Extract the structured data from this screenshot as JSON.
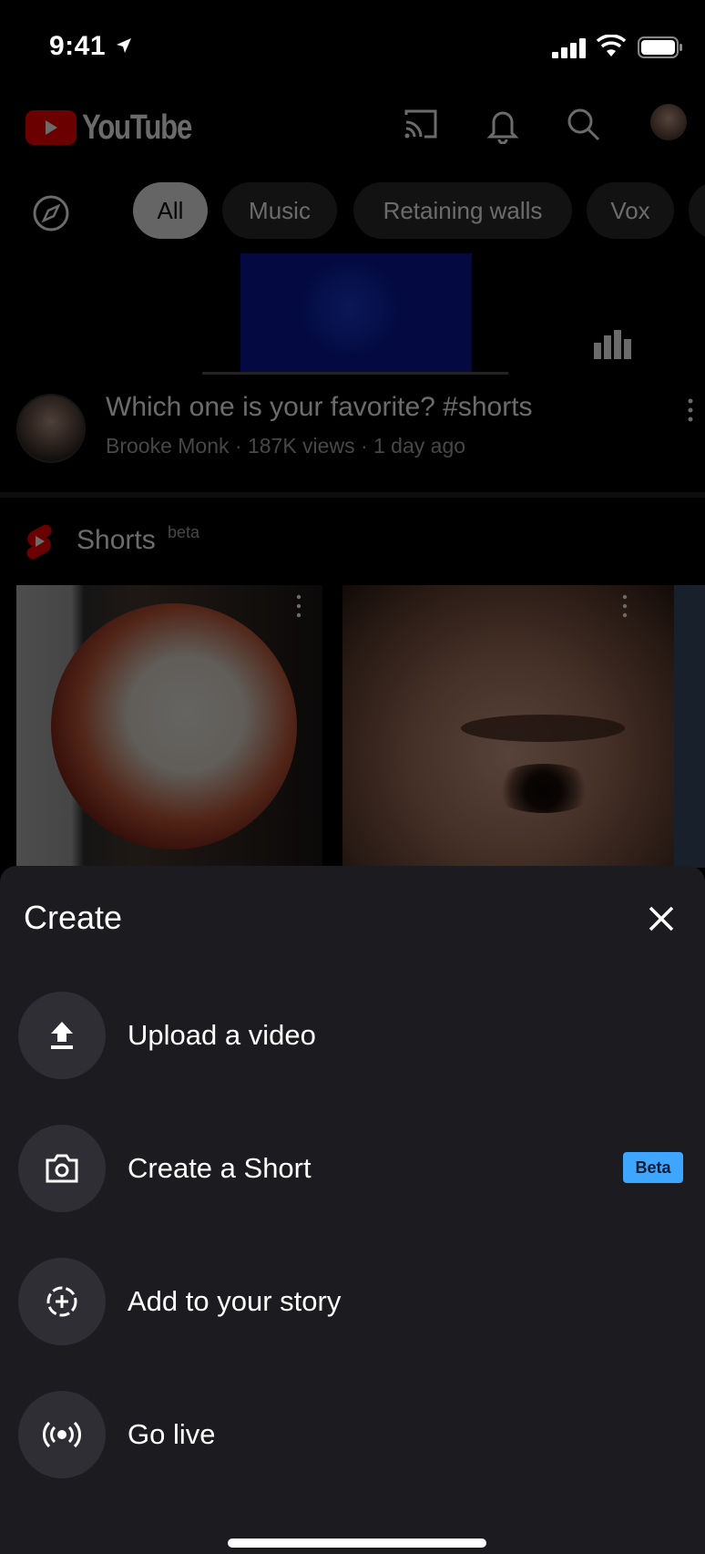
{
  "status_bar": {
    "time": "9:41"
  },
  "header": {
    "logo_text": "YouTube"
  },
  "chips": [
    {
      "label": "All",
      "active": true
    },
    {
      "label": "Music",
      "active": false
    },
    {
      "label": "Retaining walls",
      "active": false
    },
    {
      "label": "Vox",
      "active": false
    }
  ],
  "video": {
    "title": "Which one is your favorite? #shorts",
    "meta": "Brooke Monk · 187K views · 1 day ago"
  },
  "shorts": {
    "label": "Shorts",
    "badge": "beta"
  },
  "create_sheet": {
    "title": "Create",
    "items": [
      {
        "label": "Upload a video",
        "icon": "upload-icon"
      },
      {
        "label": "Create a Short",
        "icon": "camera-icon",
        "badge": "Beta"
      },
      {
        "label": "Add to your story",
        "icon": "story-add-icon"
      },
      {
        "label": "Go live",
        "icon": "live-broadcast-icon"
      }
    ]
  },
  "colors": {
    "sheet_bg": "#1c1b20",
    "accent": "#ff0000",
    "beta_badge": "#3ea6ff"
  }
}
